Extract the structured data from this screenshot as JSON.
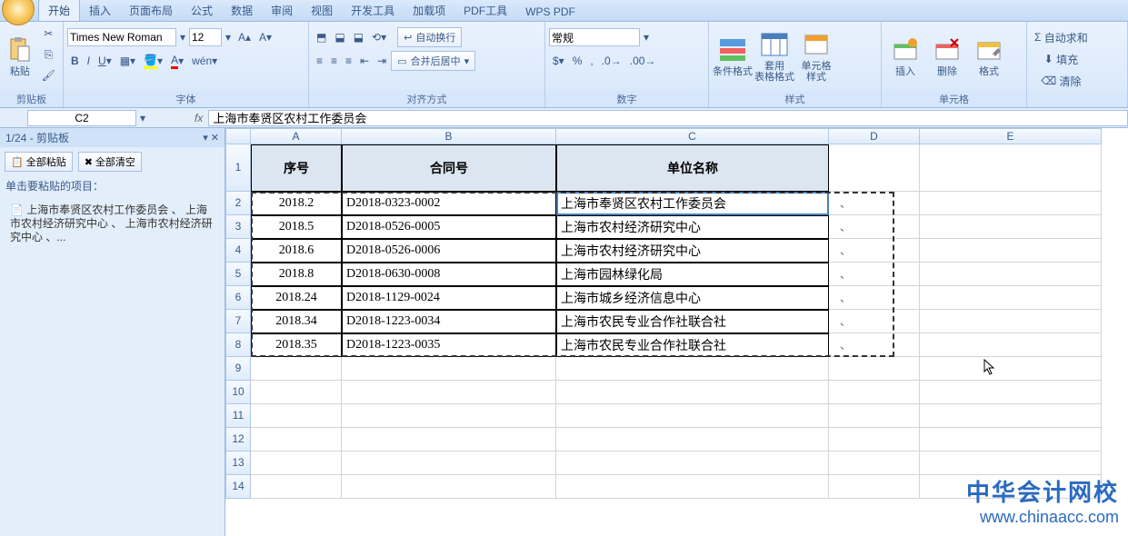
{
  "tabs": {
    "home": "开始",
    "insert": "插入",
    "layout": "页面布局",
    "formula": "公式",
    "data": "数据",
    "review": "审阅",
    "view": "视图",
    "dev": "开发工具",
    "addins": "加载项",
    "pdf": "PDF工具",
    "wps": "WPS PDF"
  },
  "ribbon": {
    "clipboard": {
      "label": "剪贴板",
      "paste": "粘贴"
    },
    "font": {
      "label": "字体",
      "name": "Times New Roman",
      "size": "12"
    },
    "align": {
      "label": "对齐方式",
      "wrap": "自动换行",
      "merge": "合并后居中"
    },
    "number": {
      "label": "数字",
      "general": "常规"
    },
    "styles": {
      "label": "样式",
      "cond": "条件格式",
      "fmt_tbl": "套用\n表格格式",
      "cell_style": "单元格\n样式"
    },
    "cells": {
      "label": "单元格",
      "insert": "插入",
      "delete": "删除",
      "format": "格式"
    },
    "editing": {
      "autosum": "自动求和",
      "fill": "填充",
      "clear": "清除"
    }
  },
  "namebox": "C2",
  "formula": "上海市奉贤区农村工作委员会",
  "clipboard_pane": {
    "title": "1/24 - 剪贴板",
    "paste_all": "全部粘贴",
    "clear_all": "全部清空",
    "hint": "单击要粘贴的项目：",
    "item": "上海市奉贤区农村工作委员会 、 上海市农村经济研究中心 、 上海市农村经济研究中心 、..."
  },
  "cols": {
    "A": 100,
    "B": 236,
    "C": 300,
    "D": 100,
    "E": 200
  },
  "headers": {
    "A": "序号",
    "B": "合同号",
    "C": "单位名称"
  },
  "rows": [
    {
      "n": 2,
      "A": "2018.2",
      "B": "D2018-0323-0002",
      "C": "上海市奉贤区农村工作委员会",
      "D": "、"
    },
    {
      "n": 3,
      "A": "2018.5",
      "B": "D2018-0526-0005",
      "C": "上海市农村经济研究中心",
      "D": "、"
    },
    {
      "n": 4,
      "A": "2018.6",
      "B": "D2018-0526-0006",
      "C": "上海市农村经济研究中心",
      "D": "、"
    },
    {
      "n": 5,
      "A": "2018.8",
      "B": "D2018-0630-0008",
      "C": "上海市园林绿化局",
      "D": "、"
    },
    {
      "n": 6,
      "A": "2018.24",
      "B": "D2018-1129-0024",
      "C": "上海市城乡经济信息中心",
      "D": "、"
    },
    {
      "n": 7,
      "A": "2018.34",
      "B": "D2018-1223-0034",
      "C": "上海市农民专业合作社联合社",
      "D": "、"
    },
    {
      "n": 8,
      "A": "2018.35",
      "B": "D2018-1223-0035",
      "C": "上海市农民专业合作社联合社",
      "D": "、"
    }
  ],
  "watermark": {
    "line1": "中华会计网校",
    "line2": "www.chinaacc.com"
  }
}
